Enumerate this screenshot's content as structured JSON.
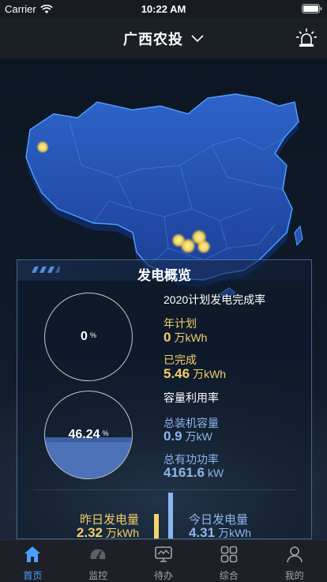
{
  "status_bar": {
    "carrier": "Carrier",
    "time": "10:22 AM"
  },
  "header": {
    "title": "广西农投"
  },
  "card": {
    "title": "发电概览"
  },
  "plan": {
    "section_title": "2020计划发电完成率",
    "rate_value": "0",
    "rate_fraction": 0,
    "percent_sign": "%",
    "annual_plan_label": "年计划",
    "annual_plan_value": "0",
    "annual_plan_unit": "万kWh",
    "completed_label": "已完成",
    "completed_value": "5.46",
    "completed_unit": "万kWh"
  },
  "capacity": {
    "section_title": "容量利用率",
    "rate_value": "46.24",
    "rate_fraction": 0.4624,
    "percent_sign": "%",
    "installed_label": "总装机容量",
    "installed_value": "0.9",
    "installed_unit": "万kW",
    "active_power_label": "总有功功率",
    "active_power_value": "4161.6",
    "active_power_unit": "kW"
  },
  "generation": {
    "yesterday_label": "昨日发电量",
    "yesterday_value": "2.32",
    "yesterday_unit": "万kWh",
    "today_label": "今日发电量",
    "today_value": "4.31",
    "today_unit": "万kWh"
  },
  "tabs": [
    {
      "label": "首页",
      "icon": "home-icon",
      "active": true
    },
    {
      "label": "监控",
      "icon": "gauge-icon",
      "active": false
    },
    {
      "label": "待办",
      "icon": "monitor-icon",
      "active": false
    },
    {
      "label": "综合",
      "icon": "grid-icon",
      "active": false
    },
    {
      "label": "我的",
      "icon": "user-icon",
      "active": false
    }
  ],
  "colors": {
    "accent_blue": "#4aa0ff",
    "gold": "#f2cf68",
    "light_blue": "#8fb5ec",
    "ring_fill": "#4e72b8"
  }
}
